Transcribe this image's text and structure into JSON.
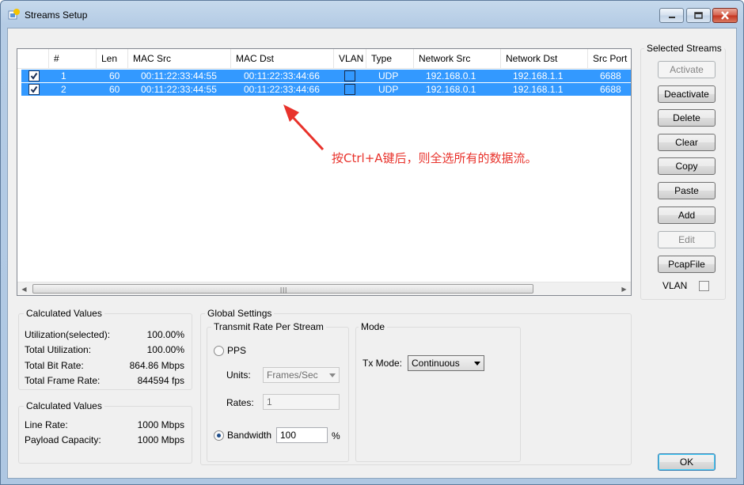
{
  "window": {
    "title": "Streams Setup"
  },
  "table": {
    "columns": [
      "#",
      "Len",
      "MAC Src",
      "MAC Dst",
      "VLAN",
      "Type",
      "Network Src",
      "Network Dst",
      "Src Port"
    ],
    "rows": [
      {
        "num": "1",
        "len": "60",
        "mac_src": "00:11:22:33:44:55",
        "mac_dst": "00:11:22:33:44:66",
        "type": "UDP",
        "net_src": "192.168.0.1",
        "net_dst": "192.168.1.1",
        "src_port": "6688"
      },
      {
        "num": "2",
        "len": "60",
        "mac_src": "00:11:22:33:44:55",
        "mac_dst": "00:11:22:33:44:66",
        "type": "UDP",
        "net_src": "192.168.0.1",
        "net_dst": "192.168.1.1",
        "src_port": "6688"
      }
    ]
  },
  "annotation": "按Ctrl+A键后，则全选所有的数据流。",
  "selected_streams": {
    "title": "Selected Streams",
    "buttons": [
      "Activate",
      "Deactivate",
      "Delete",
      "Clear",
      "Copy",
      "Paste",
      "Add",
      "Edit",
      "PcapFile"
    ],
    "vlan_label": "VLAN"
  },
  "calc1": {
    "title": "Calculated Values",
    "utilization_selected_label": "Utilization(selected):",
    "utilization_selected": "100.00%",
    "total_utilization_label": "Total Utilization:",
    "total_utilization": "100.00%",
    "total_bit_rate_label": "Total Bit Rate:",
    "total_bit_rate": "864.86 Mbps",
    "total_frame_rate_label": "Total Frame Rate:",
    "total_frame_rate": "844594 fps"
  },
  "calc2": {
    "title": "Calculated Values",
    "line_rate_label": "Line Rate:",
    "line_rate": "1000 Mbps",
    "payload_capacity_label": "Payload Capacity:",
    "payload_capacity": "1000 Mbps"
  },
  "global": {
    "title": "Global Settings",
    "transmit_title": "Transmit Rate Per Stream",
    "pps_label": "PPS",
    "units_label": "Units:",
    "units_value": "Frames/Sec",
    "rates_label": "Rates:",
    "rates_value": "1",
    "bandwidth_label": "Bandwidth",
    "bandwidth_value": "100",
    "percent": "%",
    "mode_title": "Mode",
    "tx_mode_label": "Tx Mode:",
    "tx_mode_value": "Continuous"
  },
  "ok_label": "OK",
  "colors": {
    "selection": "#3399ff",
    "annotation": "#e8322b"
  }
}
